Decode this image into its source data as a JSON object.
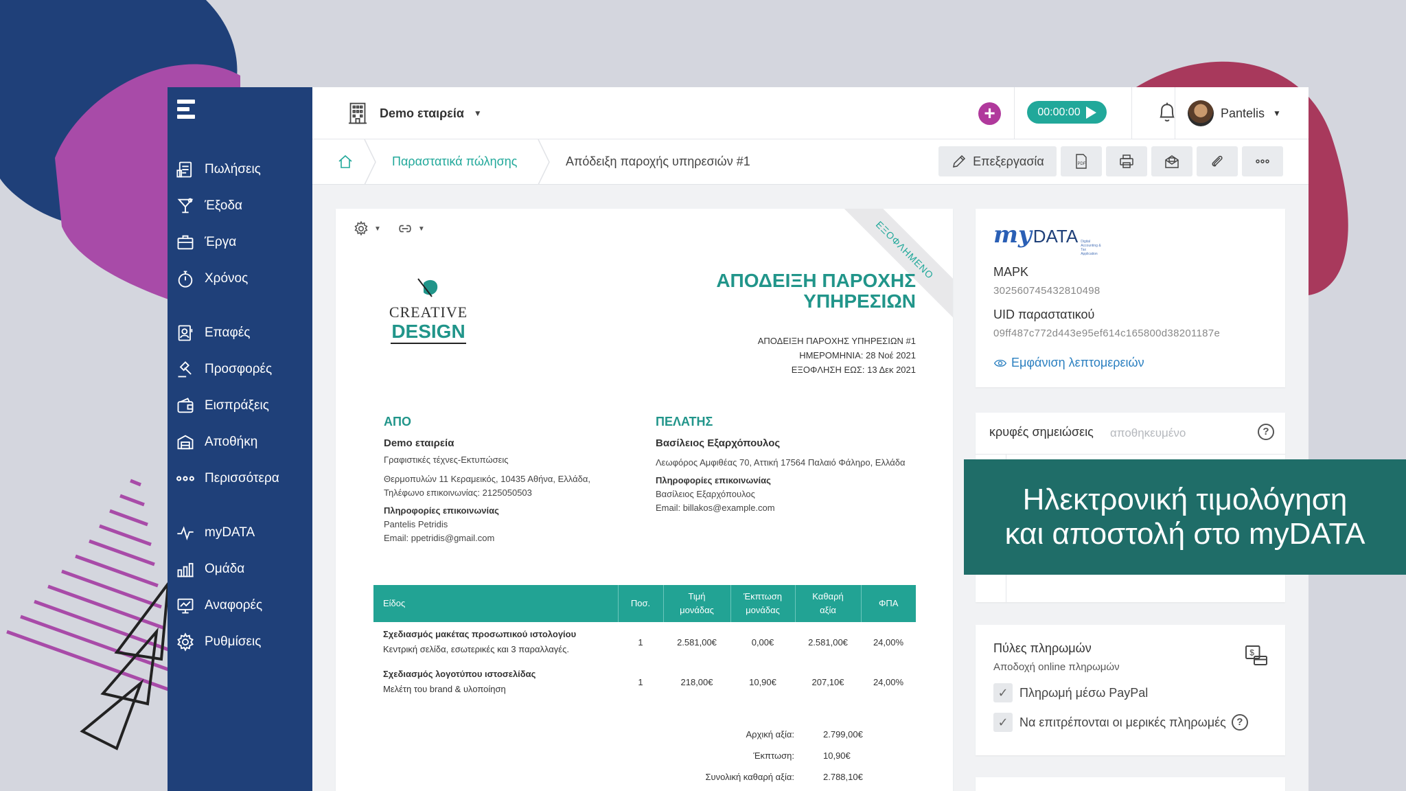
{
  "sidebar": {
    "items": [
      {
        "label": "Πωλήσεις",
        "icon": "sales-icon"
      },
      {
        "label": "Έξοδα",
        "icon": "cocktail-icon"
      },
      {
        "label": "Έργα",
        "icon": "briefcase-icon"
      },
      {
        "label": "Χρόνος",
        "icon": "stopwatch-icon"
      },
      {
        "label": "Επαφές",
        "icon": "contacts-icon"
      },
      {
        "label": "Προσφορές",
        "icon": "gavel-icon"
      },
      {
        "label": "Εισπράξεις",
        "icon": "wallet-icon"
      },
      {
        "label": "Αποθήκη",
        "icon": "warehouse-icon"
      },
      {
        "label": "Περισσότερα",
        "icon": "more-icon"
      },
      {
        "label": "myDATA",
        "icon": "pulse-icon"
      },
      {
        "label": "Ομάδα",
        "icon": "team-chart-icon"
      },
      {
        "label": "Αναφορές",
        "icon": "reports-icon"
      },
      {
        "label": "Ρυθμίσεις",
        "icon": "gear-icon"
      }
    ]
  },
  "topbar": {
    "company": "Demo εταιρεία",
    "timer": "00:00:00",
    "user": "Pantelis",
    "add_color": "#b0399c",
    "timer_color": "#21a89a"
  },
  "breadcrumb": {
    "section": "Παραστατικά πώλησης",
    "current": "Απόδειξη παροχής υπηρεσιών #1"
  },
  "toolbar": {
    "edit_label": "Επεξεργασία"
  },
  "document": {
    "ribbon": "ΕΞΟΦΛΗΜΕΝΟ",
    "title_line1": "ΑΠΟΔΕΙΞΗ ΠΑΡΟΧΗΣ",
    "title_line2": "ΥΠΗΡΕΣΙΩΝ",
    "meta": {
      "number": "ΑΠΟΔΕΙΞΗ ΠΑΡΟΧΗΣ ΥΠΗΡΕΣΙΩΝ #1",
      "date": "ΗΜΕΡΟΜΗΝΙΑ: 28 Νοέ 2021",
      "due": "ΕΞΟΦΛΗΣΗ ΕΩΣ: 13 Δεκ 2021"
    },
    "logo_text_top": "CREATIVE",
    "logo_text_bottom": "DESIGN",
    "from": {
      "heading": "ΑΠΟ",
      "name": "Demo εταιρεία",
      "activity": "Γραφιστικές τέχνες-Εκτυπώσεις",
      "address": "Θερμοπυλών 11 Κεραμεικός, 10435 Αθήνα, Ελλάδα,",
      "phone": "Τηλέφωνο επικοινωνίας: 2125050503",
      "contact_heading": "Πληροφορίες επικοινωνίας",
      "contact_name": "Pantelis Petridis",
      "email": "Email: ppetridis@gmail.com"
    },
    "to": {
      "heading": "ΠΕΛΑΤΗΣ",
      "name": "Βασίλειος Εξαρχόπουλος",
      "address": "Λεωφόρος Αμφιθέας 70, Αττική 17564 Παλαιό Φάληρο, Ελλάδα",
      "contact_heading": "Πληροφορίες επικοινωνίας",
      "contact_name": "Βασίλειος Εξαρχόπουλος",
      "email": "Email: billakos@example.com"
    },
    "table": {
      "headers": [
        "Είδος",
        "Ποσ.",
        "Τιμή μονάδας",
        "Έκπτωση μονάδας",
        "Καθαρή αξία",
        "ΦΠΑ"
      ],
      "rows": [
        {
          "title": "Σχεδιασμός μακέτας προσωπικού ιστολογίου",
          "desc": "Κεντρική σελίδα, εσωτερικές και 3 παραλλαγές.",
          "qty": "1",
          "price": "2.581,00€",
          "discount": "0,00€",
          "net": "2.581,00€",
          "vat": "24,00%"
        },
        {
          "title": "Σχεδιασμός λογοτύπου ιστοσελίδας",
          "desc": "Μελέτη του brand & υλοποίηση",
          "qty": "1",
          "price": "218,00€",
          "discount": "10,90€",
          "net": "207,10€",
          "vat": "24,00%"
        }
      ]
    },
    "totals": [
      {
        "label": "Αρχική αξία:",
        "value": "2.799,00€"
      },
      {
        "label": "Έκπτωση:",
        "value": "10,90€"
      },
      {
        "label": "Συνολική καθαρή αξία:",
        "value": "2.788,10€"
      }
    ]
  },
  "mydata_panel": {
    "logo_my": "my",
    "logo_data": "DATA",
    "logo_tag": "Digital Accounting & Tax Application",
    "mark_label": "ΜΑΡΚ",
    "mark_value": "302560745432810498",
    "uid_label": "UID παραστατικού",
    "uid_value": "09ff487c772d443e95ef614c165800d38201187e",
    "details_link": "Εμφάνιση λεπτομερειών"
  },
  "notes_panel": {
    "title": "κρυφές σημειώσεις",
    "status": "αποθηκευμένο",
    "help": "?"
  },
  "payments_panel": {
    "title": "Πύλες πληρωμών",
    "subtitle": "Αποδοχή online πληρωμών",
    "option1": "Πληρωμή μέσω PayPal",
    "option2": "Να επιτρέπονται οι μερικές πληρωμές",
    "help": "?"
  },
  "banner": {
    "line1": "Ηλεκτρονική τιμολόγηση",
    "line2": "και αποστολή στο myDATA"
  }
}
